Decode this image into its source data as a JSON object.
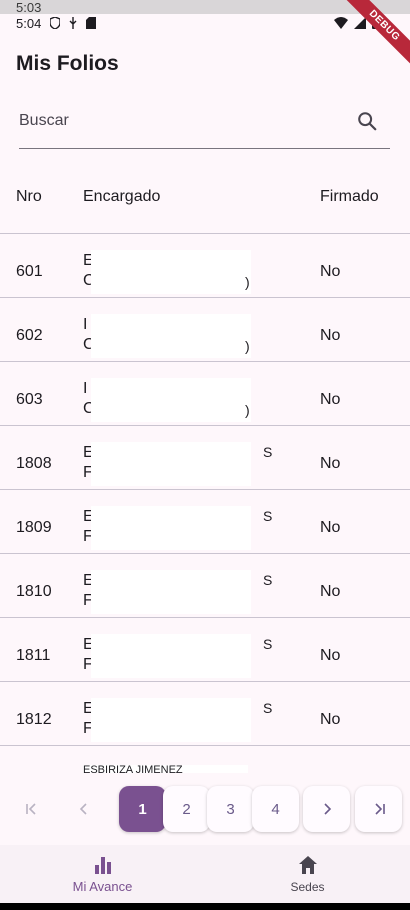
{
  "status": {
    "time_ghost": "5:03",
    "time": "5:04"
  },
  "debug_banner": "DEBUG",
  "app_bar": {
    "title": "Mis Folios"
  },
  "search": {
    "placeholder": "Buscar",
    "value": ""
  },
  "table": {
    "headers": {
      "nro": "Nro",
      "encargado": "Encargado",
      "firmado": "Firmado"
    },
    "rows": [
      {
        "nro": "601",
        "enc1": "E",
        "enc2": "C",
        "tail": ")",
        "firmado": "No"
      },
      {
        "nro": "602",
        "enc1": "I",
        "enc2": "C",
        "tail": ")",
        "firmado": "No"
      },
      {
        "nro": "603",
        "enc1": "I",
        "enc2": "C",
        "tail": ")",
        "firmado": "No"
      },
      {
        "nro": "1808",
        "enc1": "E",
        "enc2": "F",
        "tail": "S",
        "firmado": "No"
      },
      {
        "nro": "1809",
        "enc1": "E",
        "enc2": "F",
        "tail": "S",
        "firmado": "No"
      },
      {
        "nro": "1810",
        "enc1": "E",
        "enc2": "F",
        "tail": "S",
        "firmado": "No"
      },
      {
        "nro": "1811",
        "enc1": "E",
        "enc2": "F",
        "tail": "S",
        "firmado": "No"
      },
      {
        "nro": "1812",
        "enc1": "E",
        "enc2": "F",
        "tail": "S",
        "firmado": "No"
      }
    ],
    "partial_row_text": "ESBIRIZA JIMENEZ"
  },
  "pagination": {
    "first": "|<",
    "prev": "<",
    "pages": [
      "1",
      "2",
      "3",
      "4"
    ],
    "next": ">",
    "last": ">|",
    "current": "1"
  },
  "bottom_nav": {
    "items": [
      {
        "label": "Mi Avance",
        "icon": "bar-chart-icon"
      },
      {
        "label": "Sedes",
        "icon": "home-icon"
      }
    ]
  },
  "colors": {
    "primary": "#7a5190",
    "background": "#fef7fb",
    "divider": "#cac4d0"
  }
}
